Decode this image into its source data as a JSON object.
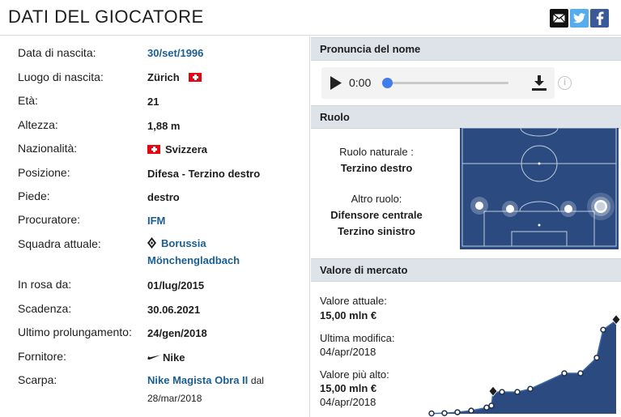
{
  "header": {
    "title": "DATI DEL GIOCATORE"
  },
  "share": {
    "email_icon": "email-icon",
    "twitter_icon": "twitter-icon",
    "facebook_icon": "facebook-icon",
    "twitter_color": "#55acee",
    "facebook_color": "#3b5998"
  },
  "details": [
    {
      "label": "Data di nascita:",
      "value": "30/set/1996"
    },
    {
      "label": "Luogo di nascita:",
      "value": "Zürich"
    },
    {
      "label": "Età:",
      "value": "21"
    },
    {
      "label": "Altezza:",
      "value": "1,88 m"
    },
    {
      "label": "Nazionalità:",
      "value": "Svizzera"
    },
    {
      "label": "Posizione:",
      "value": "Difesa - Terzino destro"
    },
    {
      "label": "Piede:",
      "value": "destro"
    },
    {
      "label": "Procuratore:",
      "value": "IFM"
    },
    {
      "label": "Squadra attuale:",
      "value": "Borussia",
      "value2": "Mönchengladbach"
    },
    {
      "label": "In rosa da:",
      "value": "01/lug/2015"
    },
    {
      "label": "Scadenza:",
      "value": "30.06.2021"
    },
    {
      "label": "Ultimo prolungamento:",
      "value": "24/gen/2018"
    },
    {
      "label": "Fornitore:",
      "value": "Nike"
    },
    {
      "label": "Scarpa:",
      "value": "Nike Magista Obra II",
      "suffix": "dal",
      "date": "28/mar/2018"
    }
  ],
  "pronunciation": {
    "heading": "Pronuncia del nome",
    "time": "0:00",
    "progress": 0,
    "info": "i"
  },
  "role": {
    "heading": "Ruolo",
    "main_label": "Ruolo naturale :",
    "main_value": "Terzino destro",
    "other_label": "Altro ruolo:",
    "other_values": [
      "Difensore centrale",
      "Terzino sinistro"
    ],
    "pitch_color": "#2a4a80"
  },
  "market_value": {
    "heading": "Valore di mercato",
    "current_label": "Valore attuale:",
    "current_value": "15,00 mln €",
    "modified_label": "Ultima modifica:",
    "modified_date": "04/apr/2018",
    "highest_label": "Valore più alto:",
    "highest_value": "15,00 mln €",
    "highest_date": "04/apr/2018"
  },
  "chart_data": {
    "type": "area",
    "series": [
      {
        "values": [
          0.05,
          0.1,
          0.25,
          0.5,
          1.0,
          1.3,
          3.5,
          3.5,
          3.5,
          4.0,
          6.5,
          6.5,
          9.0,
          13.5,
          15.0
        ]
      }
    ],
    "xlabel": "",
    "ylabel": "",
    "ylim": [
      0,
      16
    ],
    "grid": false,
    "fill_color": "#2a4a80",
    "line_color": "#3b67a8"
  }
}
